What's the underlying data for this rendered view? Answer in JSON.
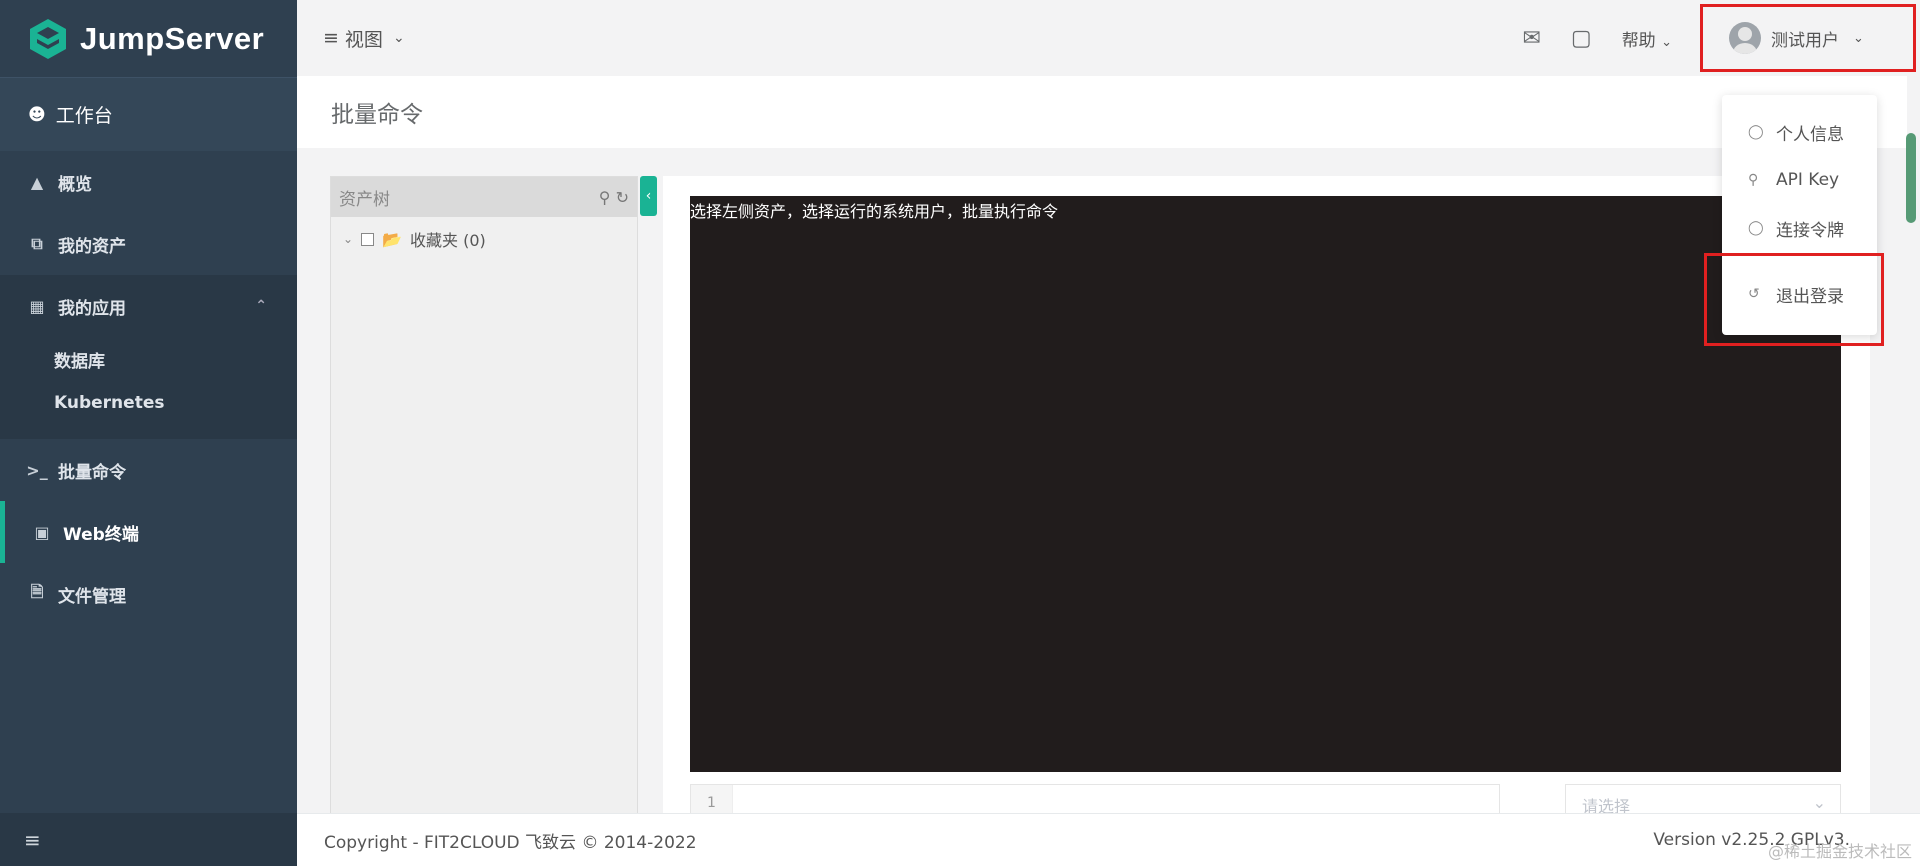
{
  "sidebar": {
    "logo_text": "JumpServer",
    "workbench": "工作台",
    "items": [
      {
        "label": "概览",
        "icon": "chart-area-icon"
      },
      {
        "label": "我的资产",
        "icon": "assets-icon"
      },
      {
        "label": "我的应用",
        "icon": "grid-icon"
      },
      {
        "label": "批量命令",
        "icon": "terminal-prompt-icon"
      },
      {
        "label": "Web终端",
        "icon": "window-icon"
      },
      {
        "label": "文件管理",
        "icon": "file-icon"
      }
    ],
    "sub_items": [
      "数据库",
      "Kubernetes"
    ]
  },
  "topbar": {
    "view_label": "视图",
    "help_label": "帮助",
    "user_name": "测试用户"
  },
  "page": {
    "title": "批量命令"
  },
  "tree": {
    "search_placeholder": "资产树",
    "favorites_label": "收藏夹 (0)"
  },
  "terminal": {
    "hint": "选择左侧资产，选择运行的系统用户，批量执行命令"
  },
  "editor": {
    "line_number": "1",
    "select_placeholder": "请选择"
  },
  "dropdown": {
    "items": [
      "个人信息",
      "API Key",
      "连接令牌",
      "退出登录"
    ]
  },
  "footer": {
    "copyright": "Copyright - FIT2CLOUD 飞致云 © 2014-2022",
    "version": "Version v2.25.2 GPLv3."
  },
  "watermark": "@稀土掘金技术社区",
  "colors": {
    "sidebar_bg": "#2f4050",
    "accent": "#1ab394",
    "highlight_box": "#e02020",
    "terminal_bg": "#211c1c"
  }
}
